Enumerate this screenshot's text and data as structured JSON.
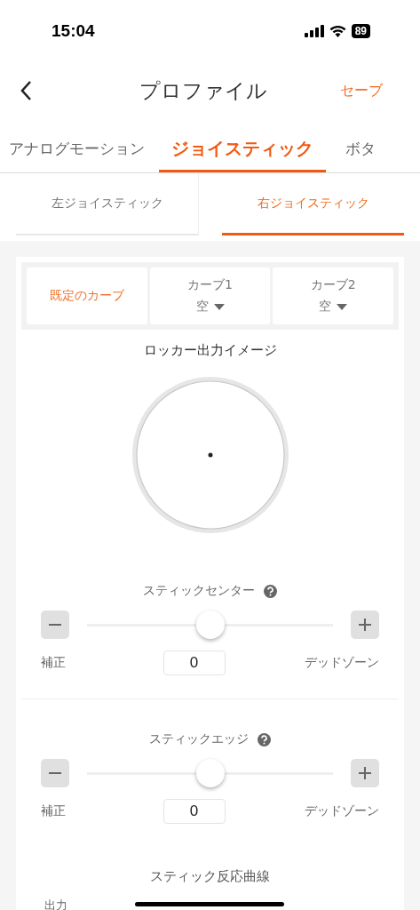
{
  "status_bar": {
    "time": "15:04",
    "battery": "89"
  },
  "nav": {
    "title": "プロファイル",
    "action": "セーブ"
  },
  "tabs": [
    {
      "label": "アナログモーション",
      "selected": false
    },
    {
      "label": "ジョイスティック",
      "selected": true
    },
    {
      "label": "ボタ",
      "selected": false
    }
  ],
  "sub_tabs": [
    {
      "label": "左ジョイスティック",
      "selected": false
    },
    {
      "label": "右ジョイスティック",
      "selected": true
    }
  ],
  "curves": [
    {
      "label": "既定のカーブ",
      "selected": true
    },
    {
      "label": "カーブ1",
      "value": "空",
      "selected": false
    },
    {
      "label": "カーブ2",
      "value": "空",
      "selected": false
    }
  ],
  "preview": {
    "title": "ロッカー出力イメージ"
  },
  "sections": [
    {
      "title": "スティックセンター",
      "level": 0.5,
      "left_label": "補正",
      "value": "0",
      "right_label": "デッドゾーン"
    },
    {
      "title": "スティックエッジ",
      "level": 0.5,
      "left_label": "補正",
      "value": "0",
      "right_label": "デッドゾーン"
    }
  ],
  "curve_section": {
    "title": "スティック反応曲線",
    "axis_label": "出力"
  }
}
